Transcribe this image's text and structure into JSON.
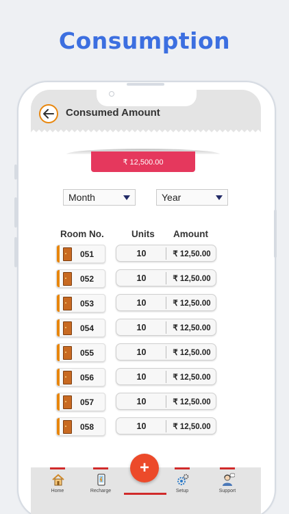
{
  "promo": {
    "title": "Consumption"
  },
  "header": {
    "title": "Consumed Amount"
  },
  "summary": {
    "total": "₹ 12,500.00"
  },
  "filters": {
    "month": "Month",
    "year": "Year"
  },
  "table": {
    "headers": {
      "room": "Room No.",
      "units": "Units",
      "amount": "Amount"
    },
    "rows": [
      {
        "room": "051",
        "units": "10",
        "amount": "₹ 12,50.00"
      },
      {
        "room": "052",
        "units": "10",
        "amount": "₹ 12,50.00"
      },
      {
        "room": "053",
        "units": "10",
        "amount": "₹ 12,50.00"
      },
      {
        "room": "054",
        "units": "10",
        "amount": "₹ 12,50.00"
      },
      {
        "room": "055",
        "units": "10",
        "amount": "₹ 12,50.00"
      },
      {
        "room": "056",
        "units": "10",
        "amount": "₹ 12,50.00"
      },
      {
        "room": "057",
        "units": "10",
        "amount": "₹ 12,50.00"
      },
      {
        "room": "058",
        "units": "10",
        "amount": "₹ 12,50.00"
      }
    ]
  },
  "nav": {
    "home": "Home",
    "recharge": "Recharge",
    "add": "+",
    "setup": "Setup",
    "support": "Support"
  },
  "colors": {
    "accent": "#3c6fe0",
    "amount_bg": "#e5385d",
    "fab": "#ec4a2a",
    "room_bar": "#e8860c"
  }
}
